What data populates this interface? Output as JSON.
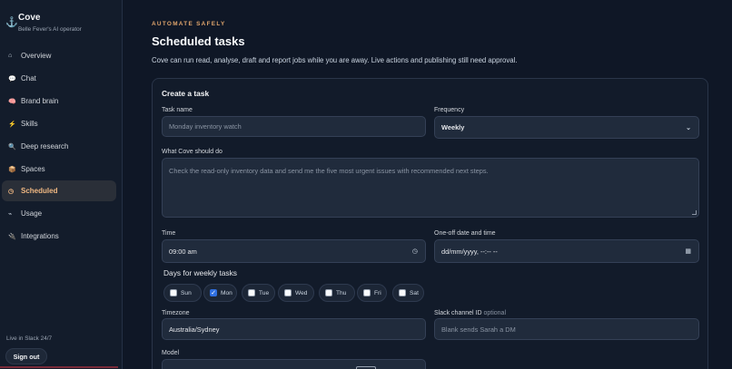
{
  "app": {
    "name": "Cove",
    "subtitle": "Belle Fever's AI operator"
  },
  "sidebar": {
    "items": [
      {
        "label": "Overview",
        "icon": "home-icon",
        "glyph": "⌂",
        "active": false
      },
      {
        "label": "Chat",
        "icon": "chat-icon",
        "glyph": "💬",
        "active": false
      },
      {
        "label": "Brand brain",
        "icon": "brain-icon",
        "glyph": "🧠",
        "active": false
      },
      {
        "label": "Skills",
        "icon": "bolt-icon",
        "glyph": "⚡",
        "active": false
      },
      {
        "label": "Deep research",
        "icon": "search-icon",
        "glyph": "🔍",
        "active": false
      },
      {
        "label": "Spaces",
        "icon": "box-icon",
        "glyph": "📦",
        "active": false
      },
      {
        "label": "Scheduled",
        "icon": "clock-icon",
        "glyph": "◷",
        "active": true
      },
      {
        "label": "Usage",
        "icon": "chart-icon",
        "glyph": "⌁",
        "active": false
      },
      {
        "label": "Integrations",
        "icon": "plug-icon",
        "glyph": "🔌",
        "active": false
      }
    ],
    "status": "Live in Slack 24/7",
    "sign_out": "Sign out"
  },
  "main": {
    "eyebrow": "AUTOMATE SAFELY",
    "title": "Scheduled tasks",
    "description": "Cove can run read, analyse, draft and report jobs while you are away. Live actions and publishing still need approval."
  },
  "form": {
    "title": "Create a task",
    "task_name": {
      "label": "Task name",
      "placeholder": "Monday inventory watch",
      "value": ""
    },
    "frequency": {
      "label": "Frequency",
      "value": "Weekly"
    },
    "instructions": {
      "label": "What Cove should do",
      "placeholder": "Check the read-only inventory data and send me the five most urgent issues with recommended next steps."
    },
    "time": {
      "label": "Time",
      "value": "09:00 am"
    },
    "oneoff": {
      "label": "One-off date and time",
      "value": "dd/mm/yyyy, --:-- --"
    },
    "days": {
      "label": "Days for weekly tasks",
      "options": [
        {
          "label": "Sun",
          "checked": false
        },
        {
          "label": "Mon",
          "checked": true
        },
        {
          "label": "Tue",
          "checked": false
        },
        {
          "label": "Wed",
          "checked": false
        },
        {
          "label": "Thu",
          "checked": false
        },
        {
          "label": "Fri",
          "checked": false
        },
        {
          "label": "Sat",
          "checked": false
        }
      ]
    },
    "timezone": {
      "label": "Timezone",
      "value": "Australia/Sydney"
    },
    "slack": {
      "label": "Slack channel ID",
      "optional": "optional",
      "placeholder": "Blank sends Sarah a DM"
    },
    "model": {
      "label": "Model"
    }
  },
  "colors": {
    "accent": "#e0a56c",
    "active_nav": "#f0b882",
    "checkbox": "#2f6fe0"
  }
}
